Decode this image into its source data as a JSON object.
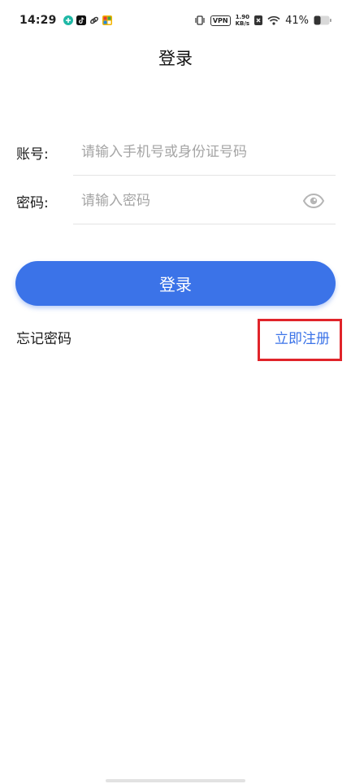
{
  "status_bar": {
    "time": "14:29",
    "vpn": "VPN",
    "speed_value": "1.90",
    "speed_unit": "KB/s",
    "battery": "41%"
  },
  "header": {
    "title": "登录"
  },
  "form": {
    "account_label": "账号:",
    "account_placeholder": "请输入手机号或身份证号码",
    "account_value": "",
    "password_label": "密码:",
    "password_placeholder": "请输入密码",
    "password_value": ""
  },
  "actions": {
    "login_label": "登录",
    "forgot_label": "忘记密码",
    "register_label": "立即注册"
  },
  "colors": {
    "accent": "#3b73e8",
    "highlight_box": "#e0242a",
    "placeholder": "#a5a5a5",
    "divider": "#e4e4e4"
  },
  "icons": {
    "status_apps": [
      "plus-circle-icon",
      "tiktok-icon",
      "link-icon",
      "grid-app-icon"
    ],
    "status_system": [
      "vibrate-icon",
      "sim-off-icon",
      "wifi-icon",
      "battery-icon"
    ],
    "password_toggle": "eye-icon"
  }
}
